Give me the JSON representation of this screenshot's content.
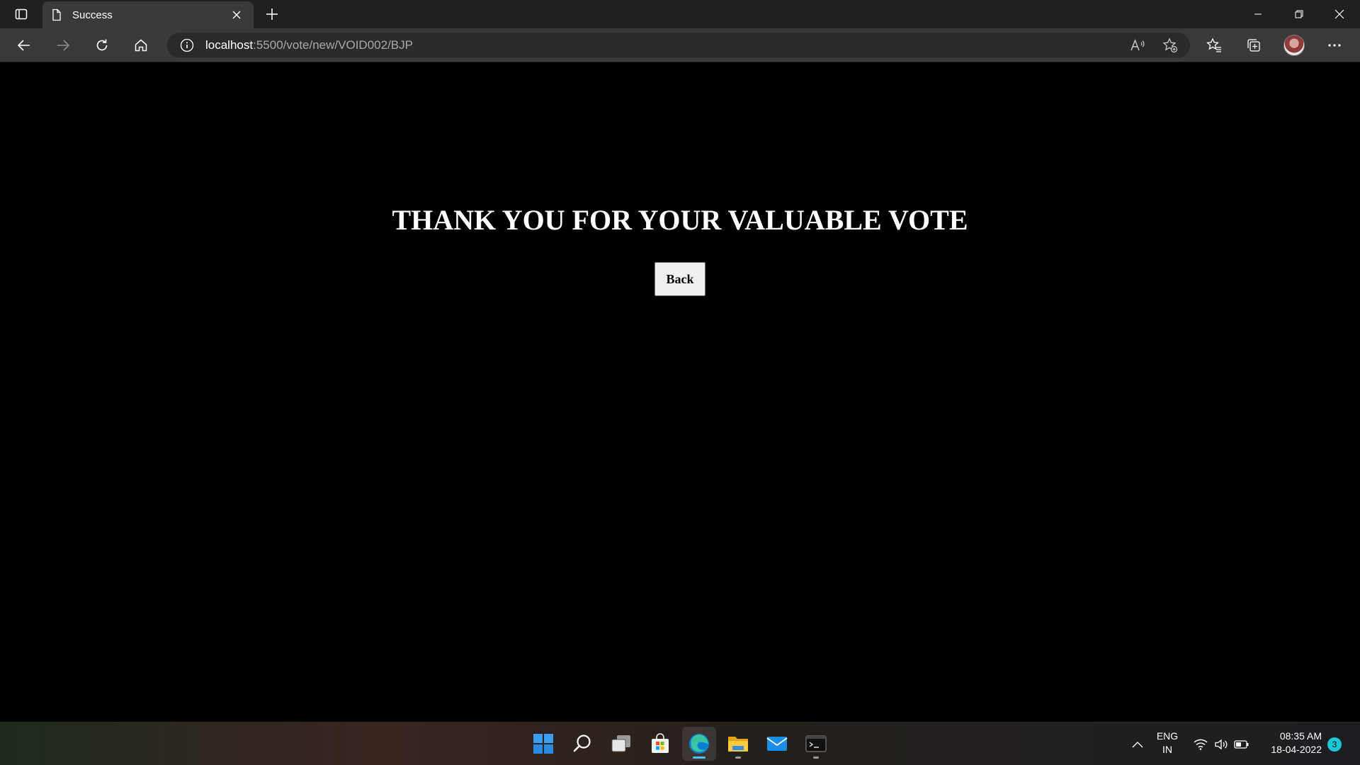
{
  "browser": {
    "tab": {
      "title": "Success"
    },
    "address": {
      "host": "localhost",
      "path": ":5500/vote/new/VOID002/BJP"
    }
  },
  "page": {
    "headline": "THANK YOU FOR YOUR VALUABLE VOTE",
    "back_label": "Back"
  },
  "taskbar": {
    "apps": [
      "start-icon",
      "search-icon",
      "task-view-icon",
      "store-icon",
      "edge-icon",
      "file-explorer-icon",
      "mail-icon",
      "terminal-icon"
    ],
    "language": {
      "line1": "ENG",
      "line2": "IN"
    },
    "clock": {
      "time": "08:35 AM",
      "date": "18-04-2022"
    },
    "notification_count": "3"
  },
  "colors": {
    "page_bg": "#000000",
    "chrome_bg": "#202020",
    "toolbar_bg": "#3a3a3a",
    "accent": "#19c8d6"
  }
}
